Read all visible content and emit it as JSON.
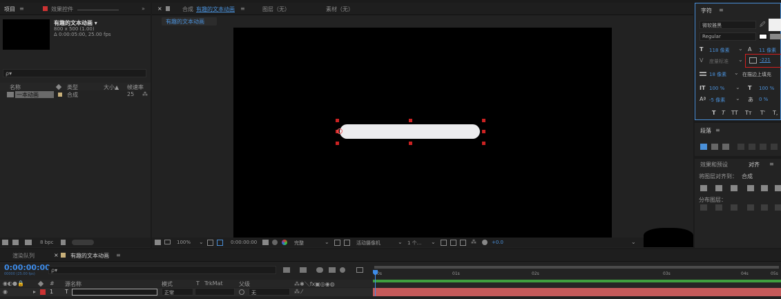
{
  "project_panel": {
    "tab_project": "项目",
    "tab_effects": "效果控件",
    "comp_title": "有趣的文本动画 ▾",
    "comp_size": "800 x 500 (1.00)",
    "comp_duration": "Δ 0:00:05:00, 25.00 fps",
    "search_placeholder": "ρ▾",
    "columns": {
      "name": "名称",
      "type": "类型",
      "size": "大小▲",
      "fps": "帧速率"
    },
    "items": [
      {
        "name": "一本动画",
        "type": "合成",
        "fps": "25"
      }
    ],
    "bpc": "8 bpc"
  },
  "comp_panel": {
    "tab_comp": "合成",
    "tab_comp_name": "有趣的文本动画",
    "tab_layer": "图层（无）",
    "tab_footage": "素材（无）",
    "subtab": "有趣的文本动画",
    "zoom": "100%",
    "timecode": "0:00:00:00",
    "quality": "完整",
    "camera": "活动摄像机",
    "views": "1 个...",
    "exposure": "+0.0"
  },
  "character_panel": {
    "title": "字符",
    "font": "微软雅黑",
    "style": "Regular",
    "font_size": "118 像素",
    "leading": "11 像素",
    "kerning": "度量标准",
    "tracking": "-221",
    "stroke_width": "18 像素",
    "stroke_type": "在描边上填充",
    "vscale": "100 %",
    "hscale": "100 %",
    "baseline": "-5 像素",
    "tsume": "0 %",
    "style_buttons": [
      "T",
      "T",
      "TT",
      "Tт",
      "T'",
      "T,"
    ]
  },
  "paragraph_panel": {
    "title": "段落"
  },
  "align_panel": {
    "tab_effects": "效果和预设",
    "tab_align": "对齐",
    "align_to_label": "将图层对齐到：",
    "align_to_value": "合成",
    "distribute_label": "分布图层："
  },
  "timeline": {
    "tab_render": "渲染队列",
    "tab_comp": "有趣的文本动画",
    "timecode": "0:00:00:00",
    "timecode_sub": "00000 (25.00 fps)",
    "search_placeholder": "ρ▾",
    "columns": {
      "num": "#",
      "layer_name": "源名称",
      "mode": "模式",
      "t": "T",
      "trkmat": "TrkMat",
      "parent": "父级"
    },
    "layer": {
      "index": "1",
      "type": "T",
      "mode": "正常",
      "parent": "无"
    },
    "ruler": [
      "0s",
      "01s",
      "02s",
      "03s",
      "04s",
      "05s"
    ]
  },
  "colors": {
    "accent": "#4a90d9",
    "timecode": "#3d8be8",
    "layer_bar": "#c55a5a",
    "work_area": "#3f9f3f",
    "highlight_box": "#d42020"
  }
}
